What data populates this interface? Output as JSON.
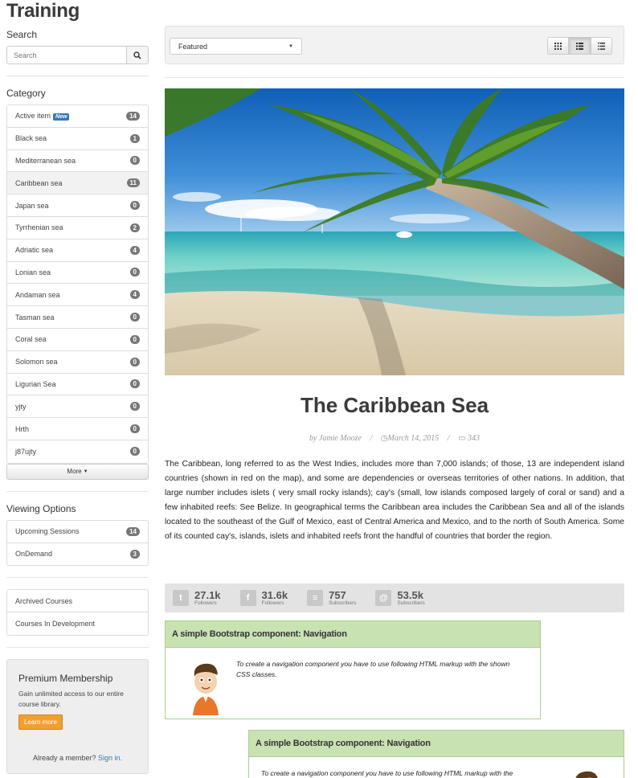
{
  "page": {
    "title": "Training"
  },
  "search": {
    "heading": "Search",
    "placeholder": "Search"
  },
  "category": {
    "heading": "Category",
    "new_label": "New",
    "items": [
      {
        "label": "Active item",
        "count": "14"
      },
      {
        "label": "Black sea",
        "count": "1"
      },
      {
        "label": "Mediterranean sea",
        "count": "0"
      },
      {
        "label": "Caribbean sea",
        "count": "11"
      },
      {
        "label": "Japan sea",
        "count": "0"
      },
      {
        "label": "Tyrrhenian sea",
        "count": "2"
      },
      {
        "label": "Adriatic sea",
        "count": "4"
      },
      {
        "label": "Lonian sea",
        "count": "0"
      },
      {
        "label": "Andaman sea",
        "count": "4"
      },
      {
        "label": "Tasman sea",
        "count": "0"
      },
      {
        "label": "Coral sea",
        "count": "0"
      },
      {
        "label": "Solomon sea",
        "count": "0"
      },
      {
        "label": "Ligurian Sea",
        "count": "0"
      },
      {
        "label": "yjty",
        "count": "0"
      },
      {
        "label": "Hrth",
        "count": "0"
      },
      {
        "label": "j87ujty",
        "count": "0"
      }
    ],
    "more_label": "More"
  },
  "viewing": {
    "heading": "Viewing Options",
    "items": [
      {
        "label": "Upcoming Sessions",
        "count": "14"
      },
      {
        "label": "OnDemand",
        "count": "3"
      }
    ]
  },
  "courses": {
    "items": [
      "Archived Courses",
      "Courses In Development"
    ]
  },
  "premium": {
    "title": "Premium Membership",
    "text": "Gain unlimited access to our entire course library.",
    "button": "Learn more",
    "already": "Already a member?",
    "signin": "Sign in."
  },
  "toolbar": {
    "sort_value": "Featured"
  },
  "article": {
    "title": "The Caribbean Sea",
    "author": "by Jamie Mooze",
    "date": "March 14, 2015",
    "comments": "343",
    "body": "The Caribbean, long referred to as the West Indies, includes more than 7,000 islands; of those, 13 are independent island countries (shown in red on the map), and some are dependencies or overseas territories of other nations. In addition, that large number includes islets ( very small rocky islands); cay's (small, low islands composed largely of coral or sand) and a few inhabited reefs: See Belize. In geographical terms the Caribbean area includes the Caribbean Sea and all of the islands located to the southeast of the Gulf of Mexico, east of Central America and Mexico, and to the north of South America. Some of its counted cay's, islands, islets and inhabited reefs front the handful of countries that border the region."
  },
  "social": [
    {
      "icon": "twitter-icon",
      "glyph": "t",
      "value": "27.1k",
      "label": "Followers"
    },
    {
      "icon": "facebook-icon",
      "glyph": "f",
      "value": "31.6k",
      "label": "Followers"
    },
    {
      "icon": "rss-icon",
      "glyph": "≡",
      "value": "757",
      "label": "Subscribers"
    },
    {
      "icon": "email-icon",
      "glyph": "@",
      "value": "53.5k",
      "label": "Subscribers"
    }
  ],
  "boxes": [
    {
      "title": "A simple Bootstrap component: Navigation",
      "text": "To create a navigation component you have to use following HTML markup with the shown CSS classes."
    },
    {
      "title": "A simple Bootstrap component: Navigation",
      "text": "To create a navigation component you have to use following HTML markup with the"
    }
  ],
  "colors": {
    "accent": "#337ab7",
    "box_head": "#c9e2b2",
    "learn_btn": "#f0a030"
  }
}
